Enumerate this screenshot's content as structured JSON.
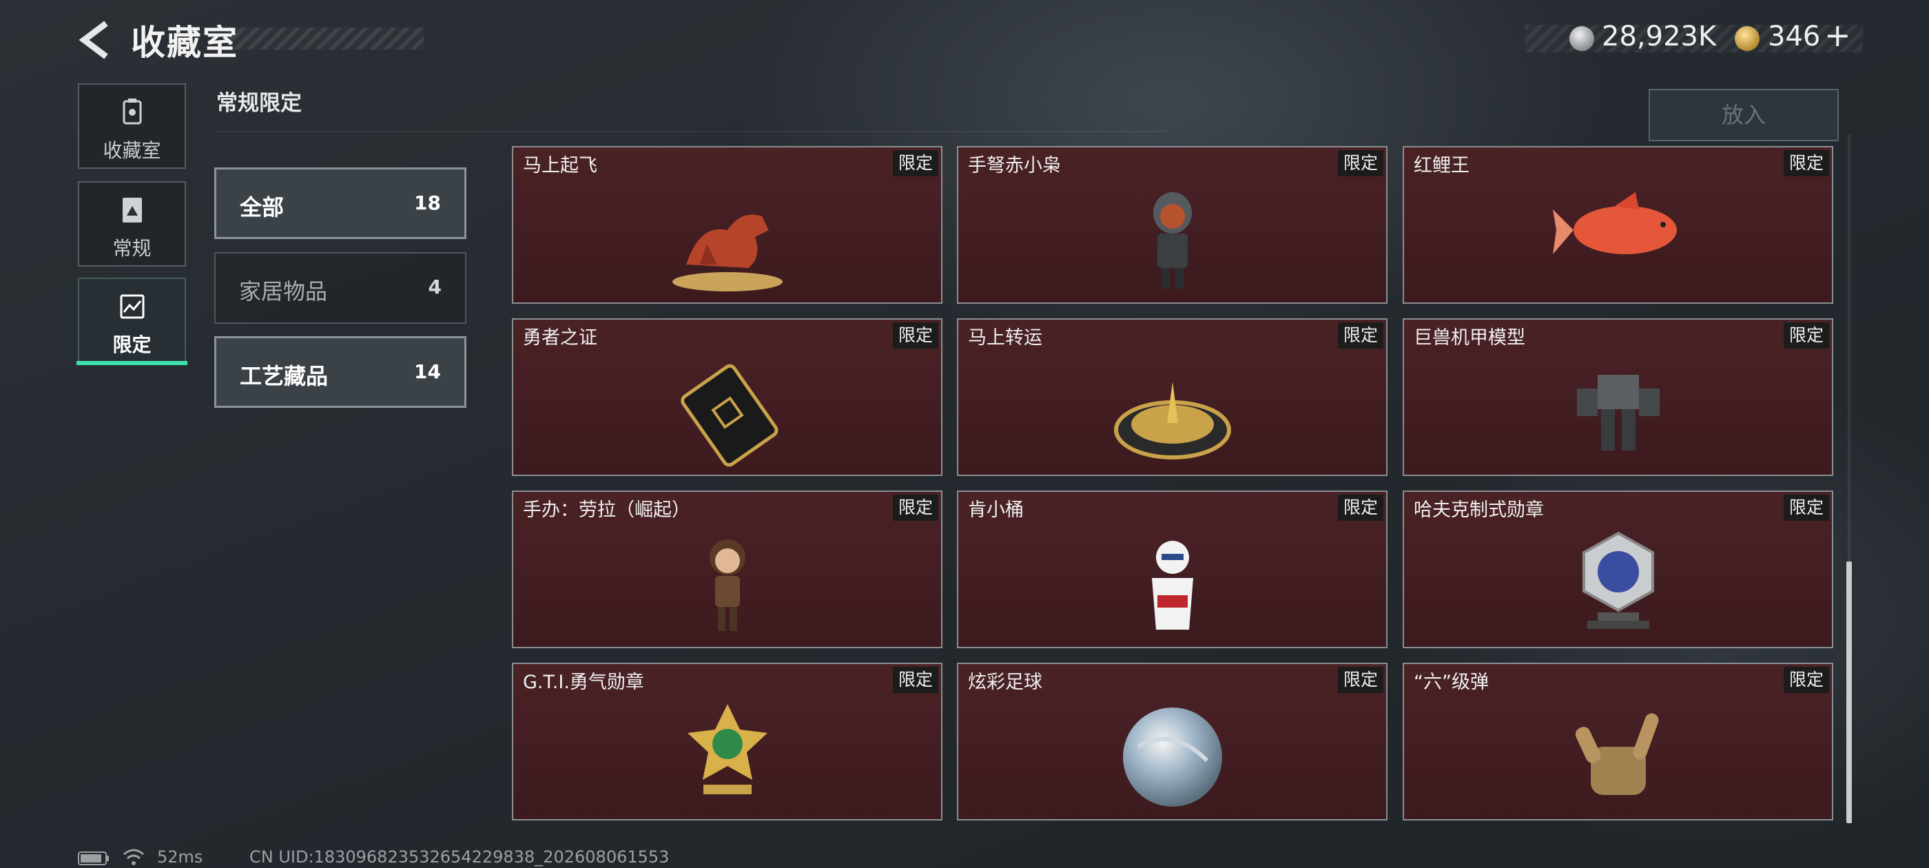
{
  "header": {
    "title": "收藏室",
    "coins": "28,923K",
    "gems": "346",
    "plus": "+"
  },
  "nav": {
    "items": [
      {
        "label": "收藏室",
        "icon": "trash-bin-icon"
      },
      {
        "label": "常规",
        "icon": "document-icon"
      },
      {
        "label": "限定",
        "icon": "map-icon"
      }
    ],
    "active": "限定"
  },
  "section": {
    "title": "常规限定"
  },
  "categories": [
    {
      "name": "全部",
      "count": "18"
    },
    {
      "name": "家居物品",
      "count": "4"
    },
    {
      "name": "工艺藏品",
      "count": "14"
    }
  ],
  "put_in_button": "放入",
  "items": [
    {
      "name": "马上起飞",
      "badge": "限定"
    },
    {
      "name": "手弩赤小枭",
      "badge": "限定"
    },
    {
      "name": "红鲤王",
      "badge": "限定"
    },
    {
      "name": "勇者之证",
      "badge": "限定"
    },
    {
      "name": "马上转运",
      "badge": "限定"
    },
    {
      "name": "巨兽机甲模型",
      "badge": "限定"
    },
    {
      "name": "手办：劳拉（崛起）",
      "badge": "限定"
    },
    {
      "name": "肯小桶",
      "badge": "限定"
    },
    {
      "name": "哈夫克制式勋章",
      "badge": "限定"
    },
    {
      "name": "G.T.I.勇气勋章",
      "badge": "限定"
    },
    {
      "name": "炫彩足球",
      "badge": "限定"
    },
    {
      "name": "“六”级弹",
      "badge": "限定"
    }
  ],
  "footer": {
    "ping": "52ms",
    "uid": "CN UID:18309682353265422983​8_202608061553"
  },
  "colors": {
    "accent": "#3ee0b0",
    "card_bg": "#4a2226",
    "badge_bg": "#1c1c1c"
  }
}
